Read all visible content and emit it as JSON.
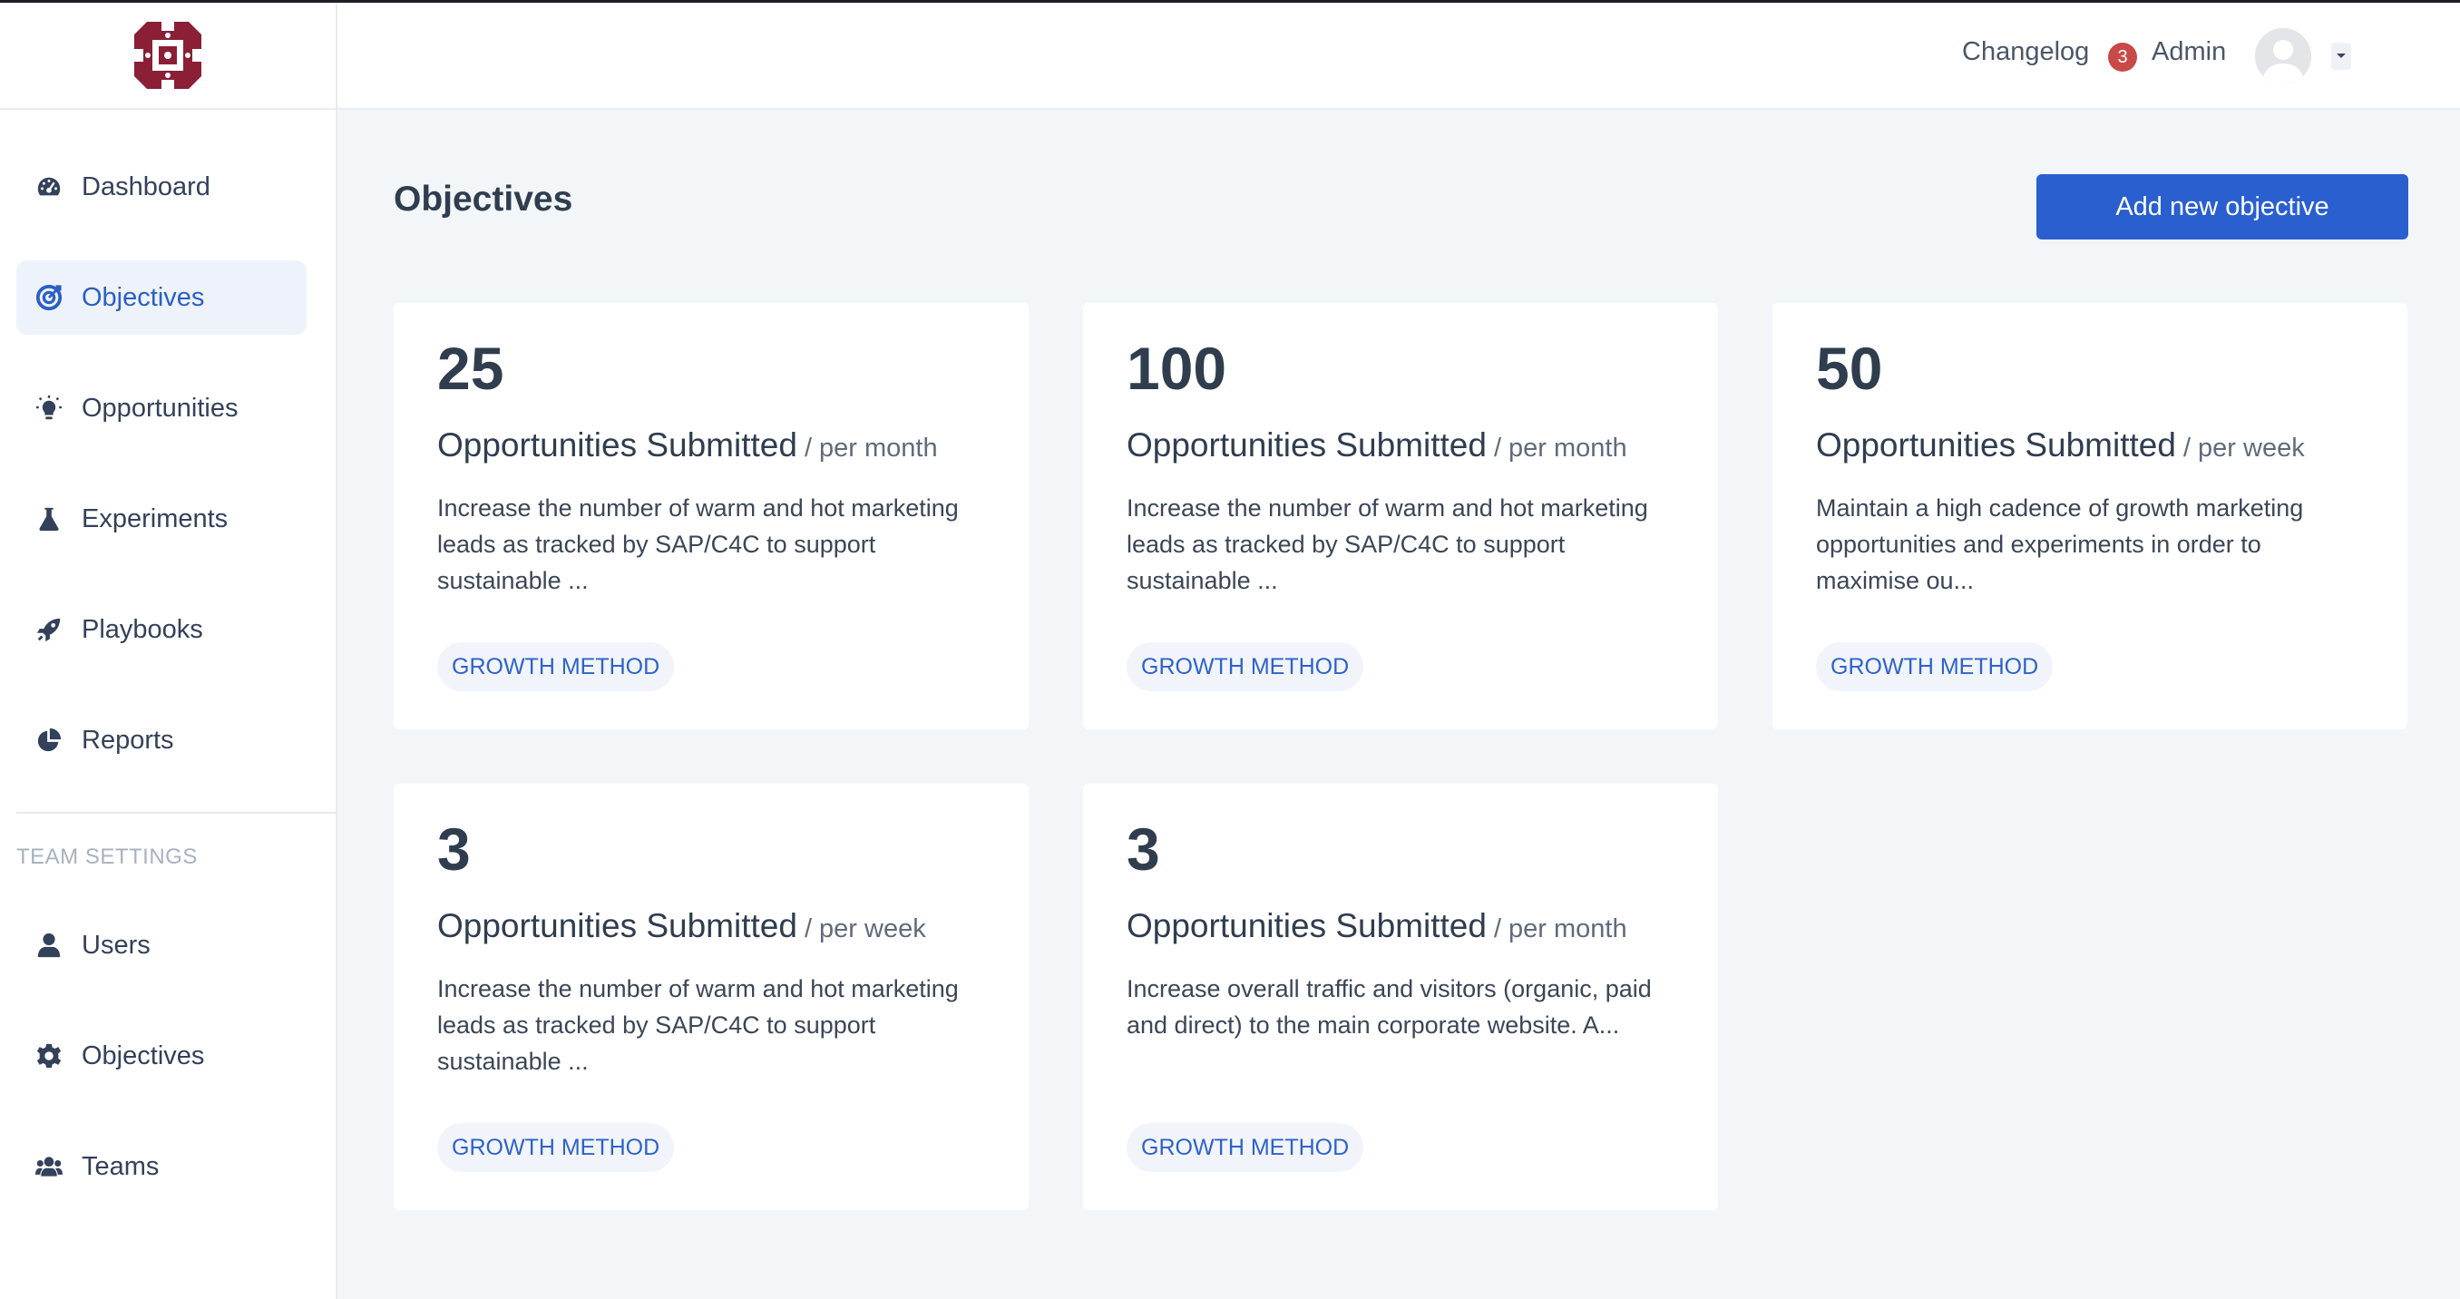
{
  "header": {
    "changelog_label": "Changelog",
    "changelog_badge": "3",
    "user_name": "Admin"
  },
  "sidebar": {
    "items": [
      {
        "label": "Dashboard",
        "icon": "dashboard-icon"
      },
      {
        "label": "Objectives",
        "icon": "target-icon",
        "active": true
      },
      {
        "label": "Opportunities",
        "icon": "lightbulb-icon"
      },
      {
        "label": "Experiments",
        "icon": "flask-icon"
      },
      {
        "label": "Playbooks",
        "icon": "rocket-icon"
      },
      {
        "label": "Reports",
        "icon": "pie-chart-icon"
      }
    ],
    "section_label": "TEAM SETTINGS",
    "settings_items": [
      {
        "label": "Users",
        "icon": "user-icon"
      },
      {
        "label": "Objectives",
        "icon": "gear-icon"
      },
      {
        "label": "Teams",
        "icon": "users-icon"
      }
    ]
  },
  "main": {
    "title": "Objectives",
    "add_button_label": "Add new objective",
    "cards": [
      {
        "value": "25",
        "metric": "Opportunities Submitted",
        "period": "/ per month",
        "description": "Increase the number of warm and hot marketing leads as tracked by SAP/C4C to support sustainable ...",
        "tag": "GROWTH METHOD"
      },
      {
        "value": "100",
        "metric": "Opportunities Submitted",
        "period": "/ per month",
        "description": "Increase the number of warm and hot marketing leads as tracked by SAP/C4C to support sustainable ...",
        "tag": "GROWTH METHOD"
      },
      {
        "value": "50",
        "metric": "Opportunities Submitted",
        "period": "/ per week",
        "description": "Maintain a high cadence of growth marketing opportunities and experiments in order to maximise ou...",
        "tag": "GROWTH METHOD"
      },
      {
        "value": "3",
        "metric": "Opportunities Submitted",
        "period": "/ per week",
        "description": "Increase the number of warm and hot marketing leads as tracked by SAP/C4C to support sustainable ...",
        "tag": "GROWTH METHOD"
      },
      {
        "value": "3",
        "metric": "Opportunities Submitted",
        "period": "/ per month",
        "description": "Increase overall traffic and visitors (organic, paid and direct) to the main corporate website. A...",
        "tag": "GROWTH METHOD"
      }
    ]
  },
  "colors": {
    "accent": "#2a5fd0",
    "badge": "#c94949",
    "logo": "#8a1f35",
    "background": "#f3f6f9"
  }
}
